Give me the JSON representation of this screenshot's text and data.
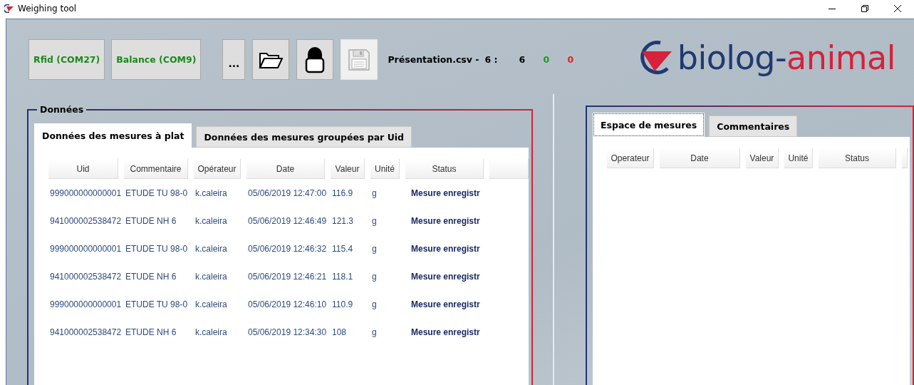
{
  "window": {
    "title": "Weighing tool"
  },
  "toolbar": {
    "buttons": [
      {
        "kind": "text",
        "label": "Rfid (COM27)",
        "disabled": false
      },
      {
        "kind": "text",
        "label": "Balance (COM9)",
        "disabled": false
      },
      {
        "kind": "text",
        "label": "...",
        "disabled": false
      },
      {
        "kind": "folder",
        "disabled": false
      },
      {
        "kind": "lock",
        "disabled": false
      },
      {
        "kind": "save",
        "disabled": true
      }
    ],
    "file": "Présentation.csv -",
    "total": "6 :",
    "counts": [
      {
        "value": "6",
        "color": "#000000"
      },
      {
        "value": "0",
        "color": "#1a9a1a"
      },
      {
        "value": "0",
        "color": "#e02020"
      }
    ]
  },
  "logo": {
    "part_1": "biolog-",
    "part_2": "animal"
  },
  "left_panel": {
    "title": "Données",
    "tabs": [
      {
        "label": "Données des mesures à plat",
        "selected": true
      },
      {
        "label": "Données des mesures groupées par Uid",
        "selected": false
      }
    ],
    "columns": [
      "Uid",
      "Commentaire",
      "Opérateur",
      "Date",
      "Valeur",
      "Unité",
      "Status"
    ],
    "rows": [
      [
        "999000000000001",
        "ETUDE TU 98-0",
        "k.caleira",
        "05/06/2019 12:47:00",
        "116.9",
        "g",
        "Mesure enregistr"
      ],
      [
        "941000002538472",
        "ETUDE NH 6",
        "k.caleira",
        "05/06/2019 12:46:49",
        "121.3",
        "g",
        "Mesure enregistr"
      ],
      [
        "999000000000001",
        "ETUDE TU 98-0",
        "k.caleira",
        "05/06/2019 12:46:32",
        "115.4",
        "g",
        "Mesure enregistr"
      ],
      [
        "941000002538472",
        "ETUDE NH 6",
        "k.caleira",
        "05/06/2019 12:46:21",
        "118.1",
        "g",
        "Mesure enregistr"
      ],
      [
        "999000000000001",
        "ETUDE TU 98-0",
        "k.caleira",
        "05/06/2019 12:46:10",
        "110.9",
        "g",
        "Mesure enregistr"
      ],
      [
        "941000002538472",
        "ETUDE NH 6",
        "k.caleira",
        "05/06/2019 12:34:30",
        "108",
        "g",
        "Mesure enregistr"
      ]
    ]
  },
  "right_panel": {
    "tabs": [
      {
        "label": "Espace de mesures",
        "selected": true
      },
      {
        "label": "Commentaires",
        "selected": false
      }
    ],
    "columns": [
      "Operateur",
      "Date",
      "Valeur",
      "Unité",
      "Status"
    ]
  }
}
